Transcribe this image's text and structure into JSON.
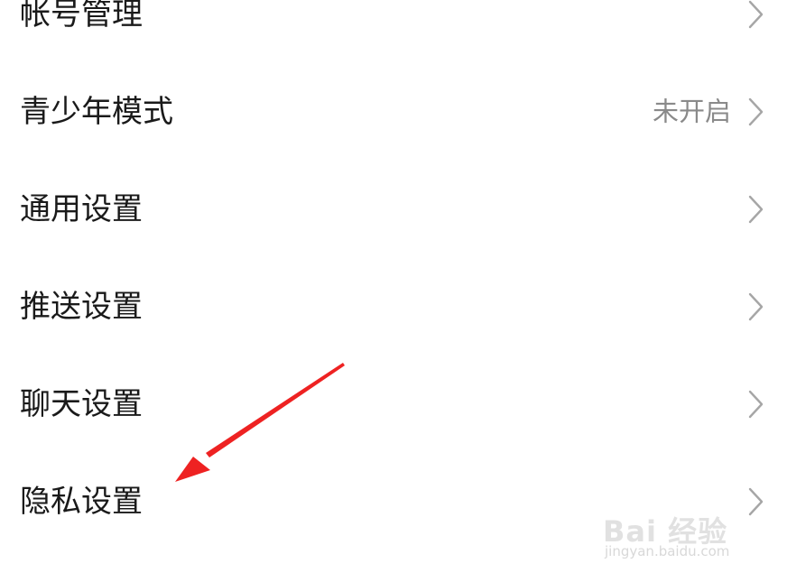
{
  "settings": {
    "items": [
      {
        "label": "帐号管理",
        "value": ""
      },
      {
        "label": "青少年模式",
        "value": "未开启"
      },
      {
        "label": "通用设置",
        "value": ""
      },
      {
        "label": "推送设置",
        "value": ""
      },
      {
        "label": "聊天设置",
        "value": ""
      },
      {
        "label": "隐私设置",
        "value": ""
      }
    ],
    "chevron_icon": "chevron-right-icon",
    "chevron_color": "#a6a6a6"
  },
  "annotation": {
    "arrow_color": "#ee2222",
    "arrow_icon": "red-arrow-annotation"
  },
  "watermark": {
    "logo": "Bai 经验",
    "url": "jingyan.baidu.com"
  }
}
